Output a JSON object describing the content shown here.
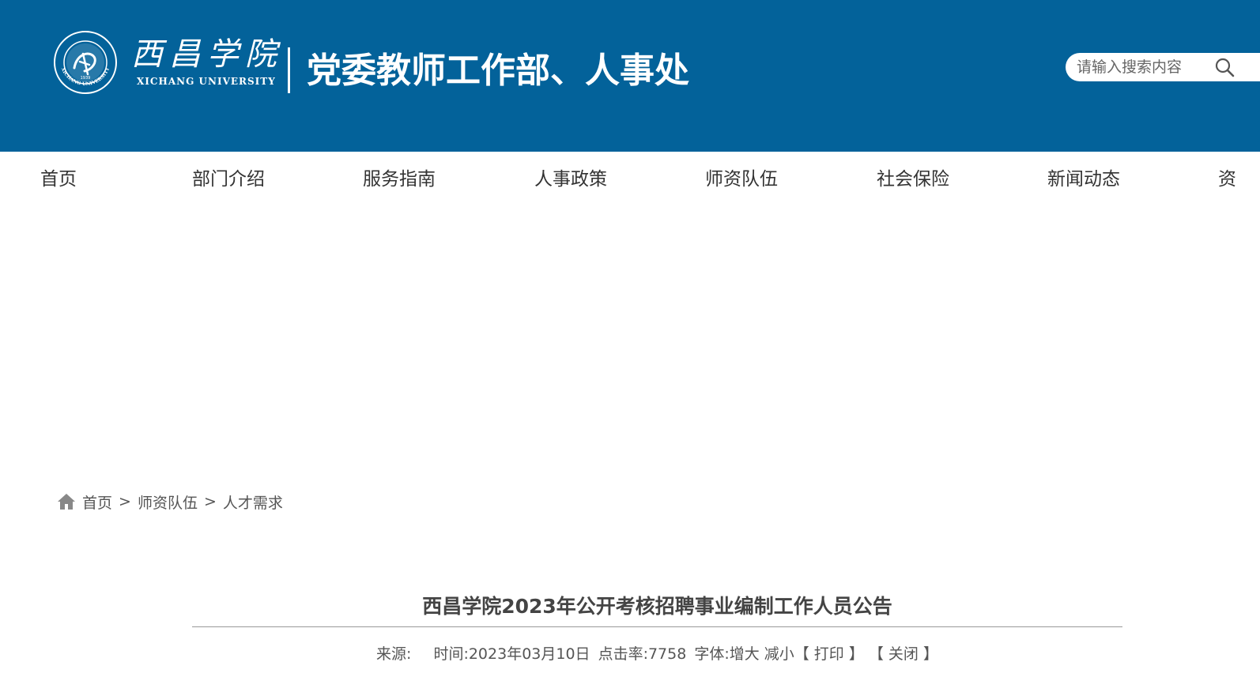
{
  "header": {
    "logo_cn": "西昌学院",
    "logo_en": "XICHANG UNIVERSITY",
    "department_title": "党委教师工作部、人事处",
    "colors": {
      "header_bg": "#03629a",
      "text": "#ffffff"
    },
    "search": {
      "placeholder": "请输入搜索内容",
      "value": "",
      "icon": "search-icon"
    }
  },
  "nav": {
    "items": [
      {
        "label": "首页"
      },
      {
        "label": "部门介绍"
      },
      {
        "label": "服务指南"
      },
      {
        "label": "人事政策"
      },
      {
        "label": "师资队伍"
      },
      {
        "label": "社会保险"
      },
      {
        "label": "新闻动态"
      },
      {
        "label": "资"
      }
    ]
  },
  "breadcrumb": {
    "icon": "home-icon",
    "items": [
      {
        "label": "首页"
      },
      {
        "label": "师资队伍"
      },
      {
        "label": "人才需求"
      }
    ],
    "separator": ">"
  },
  "article": {
    "title": "西昌学院2023年公开考核招聘事业编制工作人员公告",
    "meta": {
      "source_label": "来源:",
      "source_value": "",
      "time_label": "时间:",
      "time_value": "2023年03月10日",
      "hits_label": "点击率:",
      "hits_value": "7758",
      "font_label": "字体:",
      "increase": "增大",
      "decrease": "减小",
      "print": "【 打印 】",
      "close": "【 关闭 】"
    }
  }
}
